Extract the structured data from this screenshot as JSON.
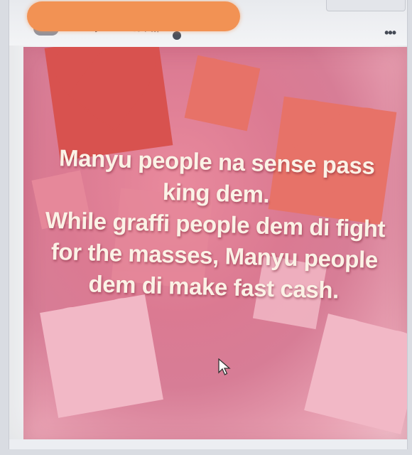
{
  "post": {
    "timestamp": "January 5 at 3:20 PM",
    "more_options_label": "•••"
  },
  "poster": {
    "lines": [
      "Manyu people na sense pass",
      "king dem.",
      "While graffi people dem di fight",
      "for the masses, Manyu people",
      "dem di make fast cash."
    ]
  },
  "icons": {
    "globe": "globe-icon",
    "more": "more-options-icon",
    "cursor": "mouse-cursor-icon"
  },
  "colors": {
    "redaction": "#f29254",
    "poster_text": "#fbf2e6",
    "background_pink": "#db7a92"
  }
}
